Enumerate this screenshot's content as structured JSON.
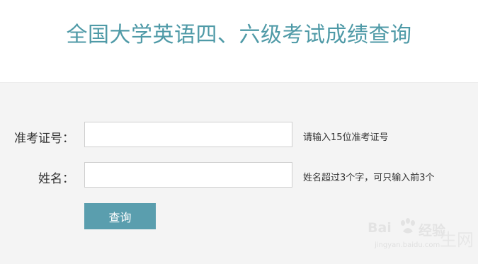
{
  "page": {
    "title": "全国大学英语四、六级考试成绩查询"
  },
  "form": {
    "exam_number": {
      "label": "准考证号：",
      "value": "",
      "hint": "请输入15位准考证号"
    },
    "name": {
      "label": "姓名：",
      "value": "",
      "hint": "姓名超过3个字，可只输入前3个"
    },
    "query_button_label": "查询"
  },
  "watermark": {
    "brand": "Bai",
    "brand_suffix": "经验",
    "url": "jingyan.baidu.com",
    "corner_text": "生网"
  },
  "colors": {
    "title": "#4f9aa7",
    "button": "#5a9eae",
    "panel": "#f4f4f4"
  }
}
